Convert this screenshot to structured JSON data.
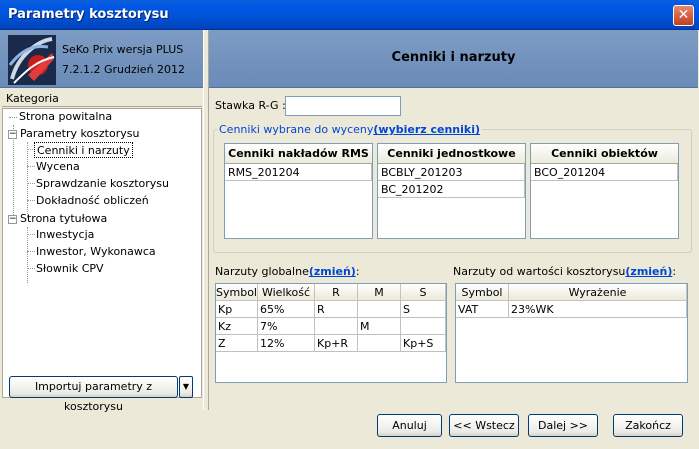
{
  "window": {
    "title": "Parametry kosztorysu",
    "close_glyph": "✕"
  },
  "app": {
    "name": "SeKo Prix wersja PLUS",
    "version": "7.2.1.2 Grudzień 2012",
    "logo_icon": "seko-logo-icon"
  },
  "sidebar": {
    "header": "Kategoria",
    "items": [
      {
        "label": "Strona powitalna"
      },
      {
        "label": "Parametry kosztorysu"
      },
      {
        "label": "Cenniki i narzuty"
      },
      {
        "label": "Wycena"
      },
      {
        "label": "Sprawdzanie kosztorysu"
      },
      {
        "label": "Dokładność obliczeń"
      },
      {
        "label": "Strona tytułowa"
      },
      {
        "label": "Inwestycja"
      },
      {
        "label": "Inwestor, Wykonawca"
      },
      {
        "label": "Słownik CPV"
      }
    ],
    "import_button": "Importuj parametry z kosztorysu",
    "import_arrow": "▼"
  },
  "main": {
    "title": "Cenniki i narzuty",
    "stawka_label": "Stawka R-G :",
    "stawka_value": "",
    "price_lists": {
      "legend_prefix": "Cenniki wybrane do wyceny",
      "legend_link": "(wybierz cenniki)",
      "rms": {
        "header": "Cenniki nakładów RMS",
        "items": [
          "RMS_201204"
        ]
      },
      "unit": {
        "header": "Cenniki jednostkowe",
        "items": [
          "BCBLY_201203",
          "BC_201202"
        ]
      },
      "objects": {
        "header": "Cenniki obiektów",
        "items": [
          "BCO_201204"
        ]
      }
    },
    "global_markups": {
      "label": "Narzuty globalne",
      "link": "(zmień)",
      "suffix": ":",
      "columns": [
        "Symbol",
        "Wielkość",
        "R",
        "M",
        "S"
      ],
      "rows": [
        [
          "Kp",
          "65%",
          "R",
          "",
          "S"
        ],
        [
          "Kz",
          "7%",
          "",
          "M",
          ""
        ],
        [
          "Z",
          "12%",
          "Kp+R",
          "",
          "Kp+S"
        ]
      ]
    },
    "value_markups": {
      "label": "Narzuty od wartości kosztorysu",
      "link": "(zmień)",
      "suffix": ":",
      "columns": [
        "Symbol",
        "Wyrażenie"
      ],
      "rows": [
        [
          "VAT",
          "23%WK"
        ]
      ]
    }
  },
  "buttons": {
    "cancel": "Anuluj",
    "back": "<< Wstecz",
    "next": "Dalej >>",
    "finish": "Zakończ"
  }
}
